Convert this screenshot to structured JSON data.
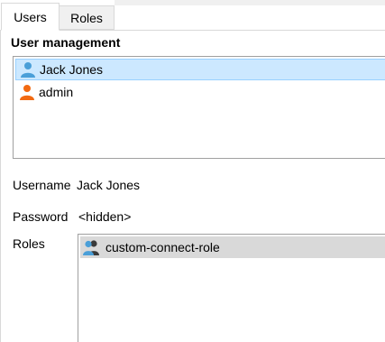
{
  "tabs": [
    {
      "label": "Users"
    },
    {
      "label": "Roles"
    }
  ],
  "section_title": "User management",
  "users": [
    {
      "name": "Jack Jones",
      "icon": "user-icon",
      "color": "#4a9fd8",
      "selected": true
    },
    {
      "name": "admin",
      "icon": "user-icon",
      "color": "#f26a12",
      "selected": false
    }
  ],
  "details": {
    "username_label": "Username",
    "username_value": "Jack Jones",
    "password_label": "Password",
    "password_value": "<hidden>",
    "roles_label": "Roles"
  },
  "roles": [
    {
      "name": "custom-connect-role",
      "icon": "role-group-icon"
    }
  ],
  "colors": {
    "selection_bg": "#cce8ff",
    "selection_border": "#99d1ff",
    "role_row_bg": "#d9d9d9"
  }
}
